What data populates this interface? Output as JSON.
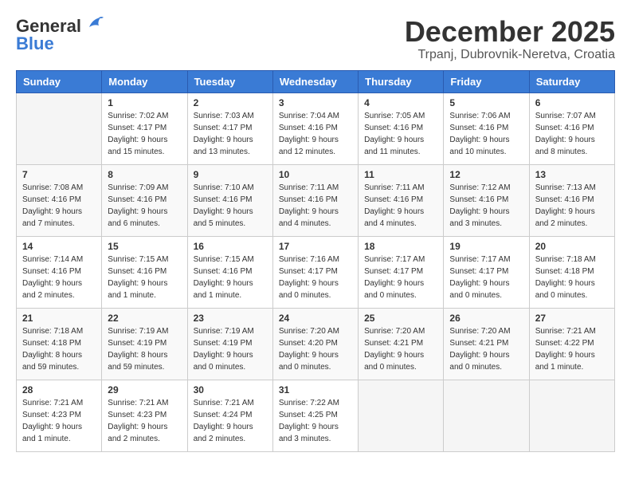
{
  "header": {
    "logo_general": "General",
    "logo_blue": "Blue",
    "month_title": "December 2025",
    "subtitle": "Trpanj, Dubrovnik-Neretva, Croatia"
  },
  "weekdays": [
    "Sunday",
    "Monday",
    "Tuesday",
    "Wednesday",
    "Thursday",
    "Friday",
    "Saturday"
  ],
  "weeks": [
    [
      {
        "day": "",
        "sunrise": "",
        "sunset": "",
        "daylight": ""
      },
      {
        "day": "1",
        "sunrise": "Sunrise: 7:02 AM",
        "sunset": "Sunset: 4:17 PM",
        "daylight": "Daylight: 9 hours and 15 minutes."
      },
      {
        "day": "2",
        "sunrise": "Sunrise: 7:03 AM",
        "sunset": "Sunset: 4:17 PM",
        "daylight": "Daylight: 9 hours and 13 minutes."
      },
      {
        "day": "3",
        "sunrise": "Sunrise: 7:04 AM",
        "sunset": "Sunset: 4:16 PM",
        "daylight": "Daylight: 9 hours and 12 minutes."
      },
      {
        "day": "4",
        "sunrise": "Sunrise: 7:05 AM",
        "sunset": "Sunset: 4:16 PM",
        "daylight": "Daylight: 9 hours and 11 minutes."
      },
      {
        "day": "5",
        "sunrise": "Sunrise: 7:06 AM",
        "sunset": "Sunset: 4:16 PM",
        "daylight": "Daylight: 9 hours and 10 minutes."
      },
      {
        "day": "6",
        "sunrise": "Sunrise: 7:07 AM",
        "sunset": "Sunset: 4:16 PM",
        "daylight": "Daylight: 9 hours and 8 minutes."
      }
    ],
    [
      {
        "day": "7",
        "sunrise": "Sunrise: 7:08 AM",
        "sunset": "Sunset: 4:16 PM",
        "daylight": "Daylight: 9 hours and 7 minutes."
      },
      {
        "day": "8",
        "sunrise": "Sunrise: 7:09 AM",
        "sunset": "Sunset: 4:16 PM",
        "daylight": "Daylight: 9 hours and 6 minutes."
      },
      {
        "day": "9",
        "sunrise": "Sunrise: 7:10 AM",
        "sunset": "Sunset: 4:16 PM",
        "daylight": "Daylight: 9 hours and 5 minutes."
      },
      {
        "day": "10",
        "sunrise": "Sunrise: 7:11 AM",
        "sunset": "Sunset: 4:16 PM",
        "daylight": "Daylight: 9 hours and 4 minutes."
      },
      {
        "day": "11",
        "sunrise": "Sunrise: 7:11 AM",
        "sunset": "Sunset: 4:16 PM",
        "daylight": "Daylight: 9 hours and 4 minutes."
      },
      {
        "day": "12",
        "sunrise": "Sunrise: 7:12 AM",
        "sunset": "Sunset: 4:16 PM",
        "daylight": "Daylight: 9 hours and 3 minutes."
      },
      {
        "day": "13",
        "sunrise": "Sunrise: 7:13 AM",
        "sunset": "Sunset: 4:16 PM",
        "daylight": "Daylight: 9 hours and 2 minutes."
      }
    ],
    [
      {
        "day": "14",
        "sunrise": "Sunrise: 7:14 AM",
        "sunset": "Sunset: 4:16 PM",
        "daylight": "Daylight: 9 hours and 2 minutes."
      },
      {
        "day": "15",
        "sunrise": "Sunrise: 7:15 AM",
        "sunset": "Sunset: 4:16 PM",
        "daylight": "Daylight: 9 hours and 1 minute."
      },
      {
        "day": "16",
        "sunrise": "Sunrise: 7:15 AM",
        "sunset": "Sunset: 4:16 PM",
        "daylight": "Daylight: 9 hours and 1 minute."
      },
      {
        "day": "17",
        "sunrise": "Sunrise: 7:16 AM",
        "sunset": "Sunset: 4:17 PM",
        "daylight": "Daylight: 9 hours and 0 minutes."
      },
      {
        "day": "18",
        "sunrise": "Sunrise: 7:17 AM",
        "sunset": "Sunset: 4:17 PM",
        "daylight": "Daylight: 9 hours and 0 minutes."
      },
      {
        "day": "19",
        "sunrise": "Sunrise: 7:17 AM",
        "sunset": "Sunset: 4:17 PM",
        "daylight": "Daylight: 9 hours and 0 minutes."
      },
      {
        "day": "20",
        "sunrise": "Sunrise: 7:18 AM",
        "sunset": "Sunset: 4:18 PM",
        "daylight": "Daylight: 9 hours and 0 minutes."
      }
    ],
    [
      {
        "day": "21",
        "sunrise": "Sunrise: 7:18 AM",
        "sunset": "Sunset: 4:18 PM",
        "daylight": "Daylight: 8 hours and 59 minutes."
      },
      {
        "day": "22",
        "sunrise": "Sunrise: 7:19 AM",
        "sunset": "Sunset: 4:19 PM",
        "daylight": "Daylight: 8 hours and 59 minutes."
      },
      {
        "day": "23",
        "sunrise": "Sunrise: 7:19 AM",
        "sunset": "Sunset: 4:19 PM",
        "daylight": "Daylight: 9 hours and 0 minutes."
      },
      {
        "day": "24",
        "sunrise": "Sunrise: 7:20 AM",
        "sunset": "Sunset: 4:20 PM",
        "daylight": "Daylight: 9 hours and 0 minutes."
      },
      {
        "day": "25",
        "sunrise": "Sunrise: 7:20 AM",
        "sunset": "Sunset: 4:21 PM",
        "daylight": "Daylight: 9 hours and 0 minutes."
      },
      {
        "day": "26",
        "sunrise": "Sunrise: 7:20 AM",
        "sunset": "Sunset: 4:21 PM",
        "daylight": "Daylight: 9 hours and 0 minutes."
      },
      {
        "day": "27",
        "sunrise": "Sunrise: 7:21 AM",
        "sunset": "Sunset: 4:22 PM",
        "daylight": "Daylight: 9 hours and 1 minute."
      }
    ],
    [
      {
        "day": "28",
        "sunrise": "Sunrise: 7:21 AM",
        "sunset": "Sunset: 4:23 PM",
        "daylight": "Daylight: 9 hours and 1 minute."
      },
      {
        "day": "29",
        "sunrise": "Sunrise: 7:21 AM",
        "sunset": "Sunset: 4:23 PM",
        "daylight": "Daylight: 9 hours and 2 minutes."
      },
      {
        "day": "30",
        "sunrise": "Sunrise: 7:21 AM",
        "sunset": "Sunset: 4:24 PM",
        "daylight": "Daylight: 9 hours and 2 minutes."
      },
      {
        "day": "31",
        "sunrise": "Sunrise: 7:22 AM",
        "sunset": "Sunset: 4:25 PM",
        "daylight": "Daylight: 9 hours and 3 minutes."
      },
      {
        "day": "",
        "sunrise": "",
        "sunset": "",
        "daylight": ""
      },
      {
        "day": "",
        "sunrise": "",
        "sunset": "",
        "daylight": ""
      },
      {
        "day": "",
        "sunrise": "",
        "sunset": "",
        "daylight": ""
      }
    ]
  ]
}
